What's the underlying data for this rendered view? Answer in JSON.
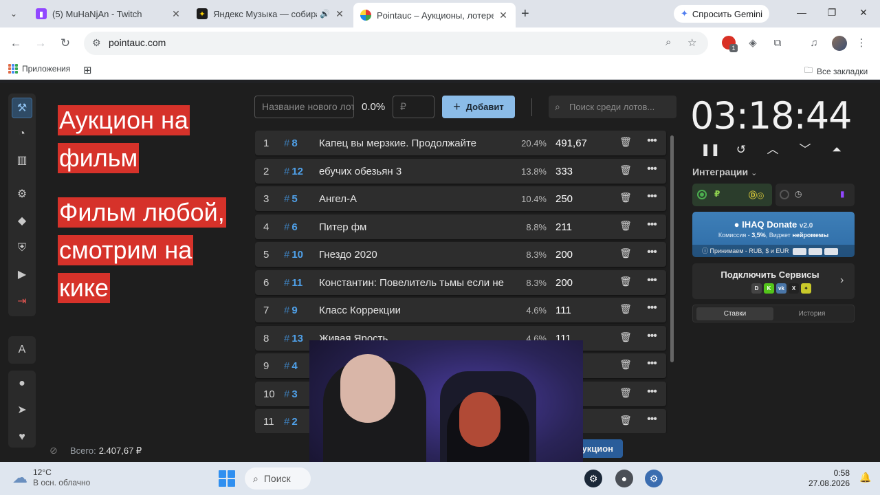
{
  "browser": {
    "tabs": [
      {
        "title": "(5) MuHaNjAn - Twitch",
        "favicon_color": "#9147ff"
      },
      {
        "title": "Яндекс Музыка — собирае",
        "favicon_color": "#1c1c1c"
      },
      {
        "title": "Pointauc – Аукционы, лотереи",
        "favicon_color": "#c2185b"
      }
    ],
    "gemini_label": "Спросить Gemini",
    "url": "pointauc.com",
    "bookmarks": {
      "apps_label": "Приложения",
      "all_label": "Все закладки"
    },
    "ext_badge": "1"
  },
  "announcement": {
    "lines_block1": [
      "Аукцион на",
      "фильм"
    ],
    "lines_block2": [
      "Фильм любой,",
      "смотрим на",
      "кике"
    ]
  },
  "add_form": {
    "name_placeholder": "Название нового лота",
    "percent": "0.0%",
    "amount_placeholder": "₽",
    "add_label": "Добавит",
    "search_placeholder": "Поиск среди лотов..."
  },
  "lots": [
    {
      "index": "1",
      "id": "8",
      "name": "Капец вы мерзкие. Продолжайте",
      "percent": "20.4%",
      "value": "491,67"
    },
    {
      "index": "2",
      "id": "12",
      "name": "ебучих обезьян 3",
      "percent": "13.8%",
      "value": "333"
    },
    {
      "index": "3",
      "id": "5",
      "name": " Ангел-А",
      "percent": "10.4%",
      "value": "250"
    },
    {
      "index": "4",
      "id": "6",
      "name": "Питер фм",
      "percent": "8.8%",
      "value": "211"
    },
    {
      "index": "5",
      "id": "10",
      "name": "Гнездо 2020",
      "percent": "8.3%",
      "value": "200"
    },
    {
      "index": "6",
      "id": "11",
      "name": "Константин: Повелитель тьмы если не",
      "percent": "8.3%",
      "value": "200"
    },
    {
      "index": "7",
      "id": "9",
      "name": "Класс Коррекции",
      "percent": "4.6%",
      "value": "111"
    },
    {
      "index": "8",
      "id": "13",
      "name": "Живая Ярость",
      "percent": "4.6%",
      "value": "111"
    },
    {
      "index": "9",
      "id": "4",
      "name": "",
      "percent": "",
      "value": ""
    },
    {
      "index": "10",
      "id": "3",
      "name": "",
      "percent": "",
      "value": ""
    },
    {
      "index": "11",
      "id": "2",
      "name": "",
      "percent": "",
      "value": ""
    }
  ],
  "total": {
    "label": "Всего:",
    "value": "2.407,67 ₽"
  },
  "start_button": "укцион",
  "timer": "03:18:44",
  "integrations": {
    "label": "Интеграции",
    "donate_title": "IHAQ Donate",
    "donate_version": "v2.0",
    "donate_fee_prefix": "Комиссия - ",
    "donate_fee": "3,5%",
    "donate_fee_mid": ", Виджет ",
    "donate_fee_suffix": "нейромемы",
    "donate_accept": "Принимаем - RUB, $ и EUR",
    "connect_label": "Подключить Сервисы",
    "tab_bids": "Ставки",
    "tab_history": "История"
  },
  "taskbar": {
    "temp": "12°C",
    "weather": "В осн. облачно",
    "search": "Поиск",
    "time": "0:58",
    "date": "27.08.2026"
  },
  "colors": {
    "accent_blue": "#8bbce8",
    "announce_red": "#d6322a",
    "lot_id_blue": "#4fa0e8"
  }
}
